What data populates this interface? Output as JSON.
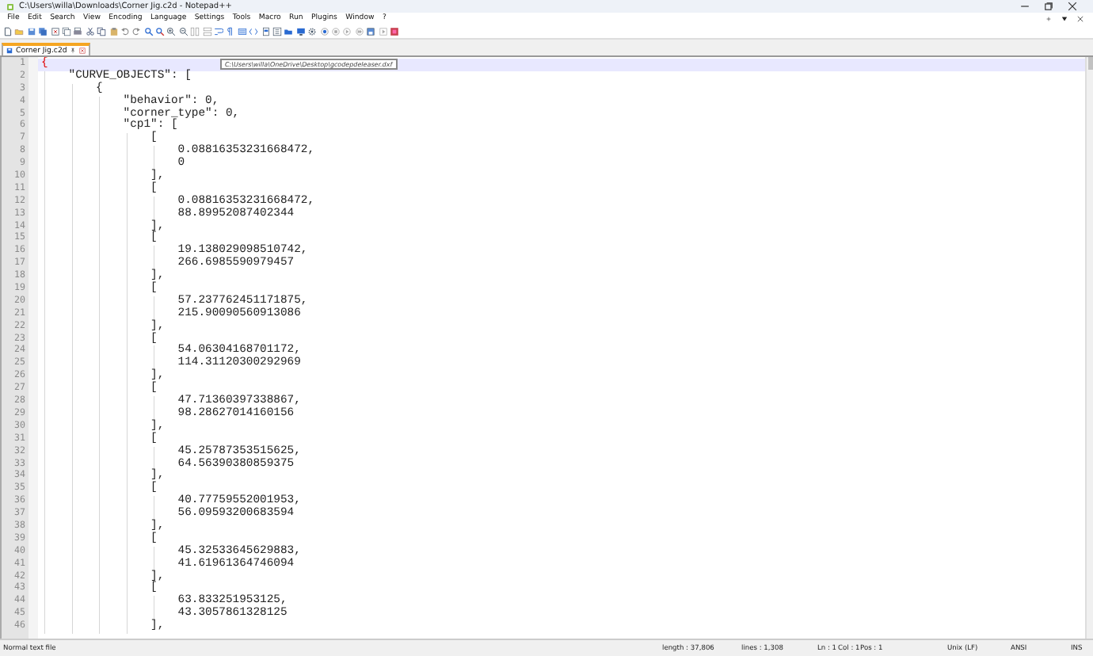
{
  "window": {
    "title": "C:\\Users\\willa\\Downloads\\Corner Jig.c2d - Notepad++"
  },
  "menu": [
    "File",
    "Edit",
    "Search",
    "View",
    "Encoding",
    "Language",
    "Settings",
    "Tools",
    "Macro",
    "Run",
    "Plugins",
    "Window",
    "?"
  ],
  "tabs": [
    {
      "label": "Corner Jig.c2d",
      "selected": true
    }
  ],
  "tooltip": "C:\\Users\\willa\\OneDrive\\Desktop\\gcodepdeleaser.dxf",
  "editor": {
    "lines": [
      {
        "number": "1",
        "text": "{",
        "current": true,
        "brace_match": true
      },
      {
        "number": "2",
        "text": "    \"CURVE_OBJECTS\": [",
        "current": false,
        "brace_match": false
      },
      {
        "number": "3",
        "text": "        {",
        "current": false,
        "brace_match": false
      },
      {
        "number": "4",
        "text": "            \"behavior\": 0,",
        "current": false,
        "brace_match": false
      },
      {
        "number": "5",
        "text": "            \"corner_type\": 0,",
        "current": false,
        "brace_match": false
      },
      {
        "number": "6",
        "text": "            \"cp1\": [",
        "current": false,
        "brace_match": false
      },
      {
        "number": "7",
        "text": "                [",
        "current": false,
        "brace_match": false
      },
      {
        "number": "8",
        "text": "                    0.08816353231668472,",
        "current": false,
        "brace_match": false
      },
      {
        "number": "9",
        "text": "                    0",
        "current": false,
        "brace_match": false
      },
      {
        "number": "10",
        "text": "                ],",
        "current": false,
        "brace_match": false
      },
      {
        "number": "11",
        "text": "                [",
        "current": false,
        "brace_match": false
      },
      {
        "number": "12",
        "text": "                    0.08816353231668472,",
        "current": false,
        "brace_match": false
      },
      {
        "number": "13",
        "text": "                    88.89952087402344",
        "current": false,
        "brace_match": false
      },
      {
        "number": "14",
        "text": "                ],",
        "current": false,
        "brace_match": false
      },
      {
        "number": "15",
        "text": "                [",
        "current": false,
        "brace_match": false
      },
      {
        "number": "16",
        "text": "                    19.138029098510742,",
        "current": false,
        "brace_match": false
      },
      {
        "number": "17",
        "text": "                    266.6985590979457",
        "current": false,
        "brace_match": false
      },
      {
        "number": "18",
        "text": "                ],",
        "current": false,
        "brace_match": false
      },
      {
        "number": "19",
        "text": "                [",
        "current": false,
        "brace_match": false
      },
      {
        "number": "20",
        "text": "                    57.237762451171875,",
        "current": false,
        "brace_match": false
      },
      {
        "number": "21",
        "text": "                    215.90090560913086",
        "current": false,
        "brace_match": false
      },
      {
        "number": "22",
        "text": "                ],",
        "current": false,
        "brace_match": false
      },
      {
        "number": "23",
        "text": "                [",
        "current": false,
        "brace_match": false
      },
      {
        "number": "24",
        "text": "                    54.06304168701172,",
        "current": false,
        "brace_match": false
      },
      {
        "number": "25",
        "text": "                    114.31120300292969",
        "current": false,
        "brace_match": false
      },
      {
        "number": "26",
        "text": "                ],",
        "current": false,
        "brace_match": false
      },
      {
        "number": "27",
        "text": "                [",
        "current": false,
        "brace_match": false
      },
      {
        "number": "28",
        "text": "                    47.71360397338867,",
        "current": false,
        "brace_match": false
      },
      {
        "number": "29",
        "text": "                    98.28627014160156",
        "current": false,
        "brace_match": false
      },
      {
        "number": "30",
        "text": "                ],",
        "current": false,
        "brace_match": false
      },
      {
        "number": "31",
        "text": "                [",
        "current": false,
        "brace_match": false
      },
      {
        "number": "32",
        "text": "                    45.25787353515625,",
        "current": false,
        "brace_match": false
      },
      {
        "number": "33",
        "text": "                    64.56390380859375",
        "current": false,
        "brace_match": false
      },
      {
        "number": "34",
        "text": "                ],",
        "current": false,
        "brace_match": false
      },
      {
        "number": "35",
        "text": "                [",
        "current": false,
        "brace_match": false
      },
      {
        "number": "36",
        "text": "                    40.77759552001953,",
        "current": false,
        "brace_match": false
      },
      {
        "number": "37",
        "text": "                    56.09593200683594",
        "current": false,
        "brace_match": false
      },
      {
        "number": "38",
        "text": "                ],",
        "current": false,
        "brace_match": false
      },
      {
        "number": "39",
        "text": "                [",
        "current": false,
        "brace_match": false
      },
      {
        "number": "40",
        "text": "                    45.32533645629883,",
        "current": false,
        "brace_match": false
      },
      {
        "number": "41",
        "text": "                    41.61961364746094",
        "current": false,
        "brace_match": false
      },
      {
        "number": "42",
        "text": "                ],",
        "current": false,
        "brace_match": false
      },
      {
        "number": "43",
        "text": "                [",
        "current": false,
        "brace_match": false
      },
      {
        "number": "44",
        "text": "                    63.833251953125,",
        "current": false,
        "brace_match": false
      },
      {
        "number": "45",
        "text": "                    43.3057861328125",
        "current": false,
        "brace_match": false
      },
      {
        "number": "46",
        "text": "                ],",
        "current": false,
        "brace_match": false
      }
    ]
  },
  "status_bar": {
    "file_type": "Normal text file",
    "length": "length : 37,806",
    "lines": "lines : 1,308",
    "ln": "Ln : 1",
    "col": "Col : 1",
    "pos": "Pos : 1",
    "eol": "Unix (LF)",
    "encoding": "ANSI",
    "mode": "INS"
  }
}
